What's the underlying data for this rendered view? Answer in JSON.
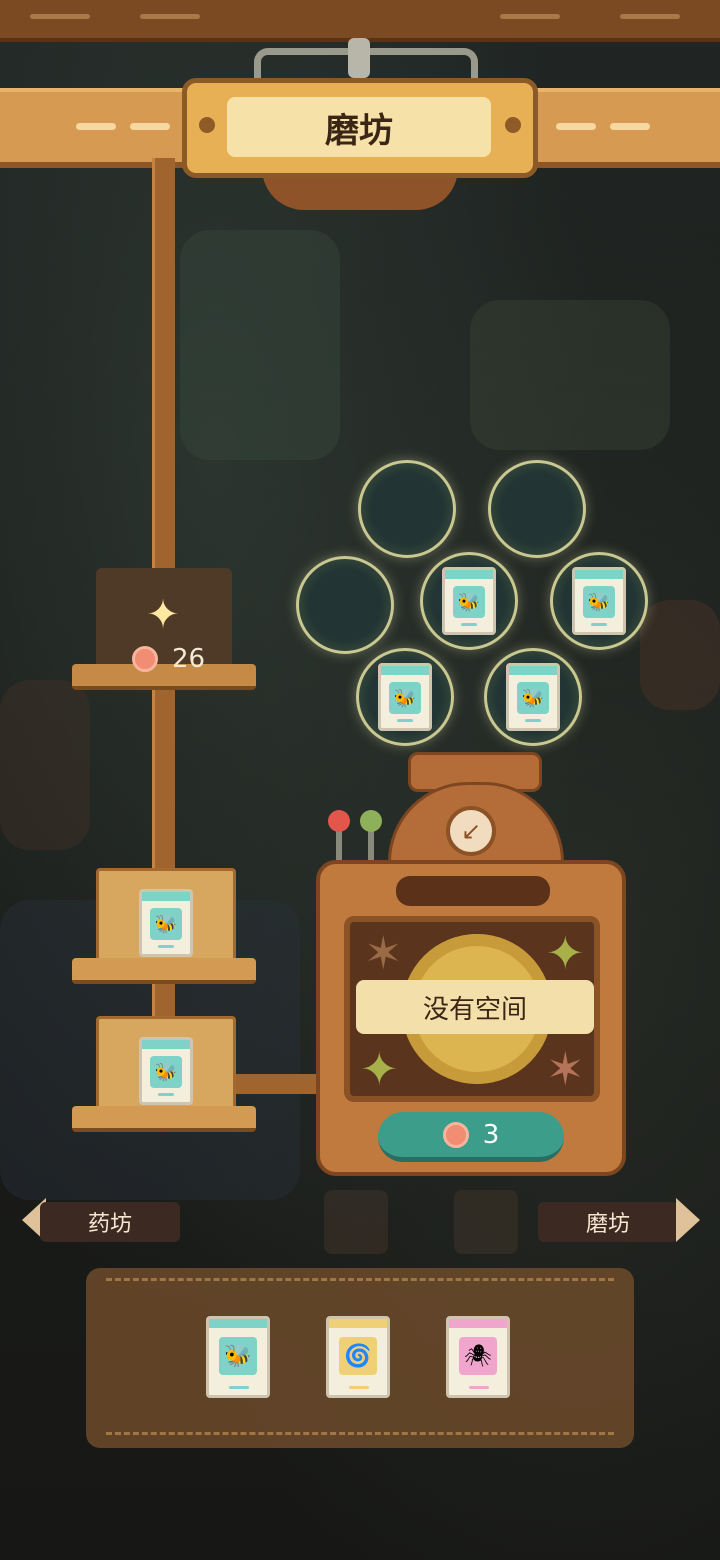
{
  "header": {
    "title": "磨坊"
  },
  "left_hook": {
    "cost_value": "26"
  },
  "machine": {
    "status_text": "没有空间",
    "cost_value": "3"
  },
  "nav": {
    "prev_label": "药坊",
    "next_label": "磨坊"
  },
  "bubbles": [
    {
      "empty": true
    },
    {
      "empty": true
    },
    {
      "empty": true
    },
    {
      "icon": "bee-packet-icon"
    },
    {
      "icon": "bee-packet-icon"
    },
    {
      "icon": "bee-packet-icon"
    },
    {
      "icon": "bee-packet-icon"
    }
  ],
  "queue_slots": [
    {
      "icon": "bee-packet-icon"
    },
    {
      "icon": "bee-packet-icon"
    }
  ],
  "inventory": [
    {
      "icon": "bee-packet-icon",
      "color": "#7fd2c8"
    },
    {
      "icon": "spiral-shell-packet-icon",
      "color": "#f0d077"
    },
    {
      "icon": "spider-packet-icon",
      "color": "#f0a6cc"
    }
  ],
  "colors": {
    "accent_teal": "#3d9d8b",
    "wood": "#c07a3e",
    "coin": "#f08d72"
  }
}
